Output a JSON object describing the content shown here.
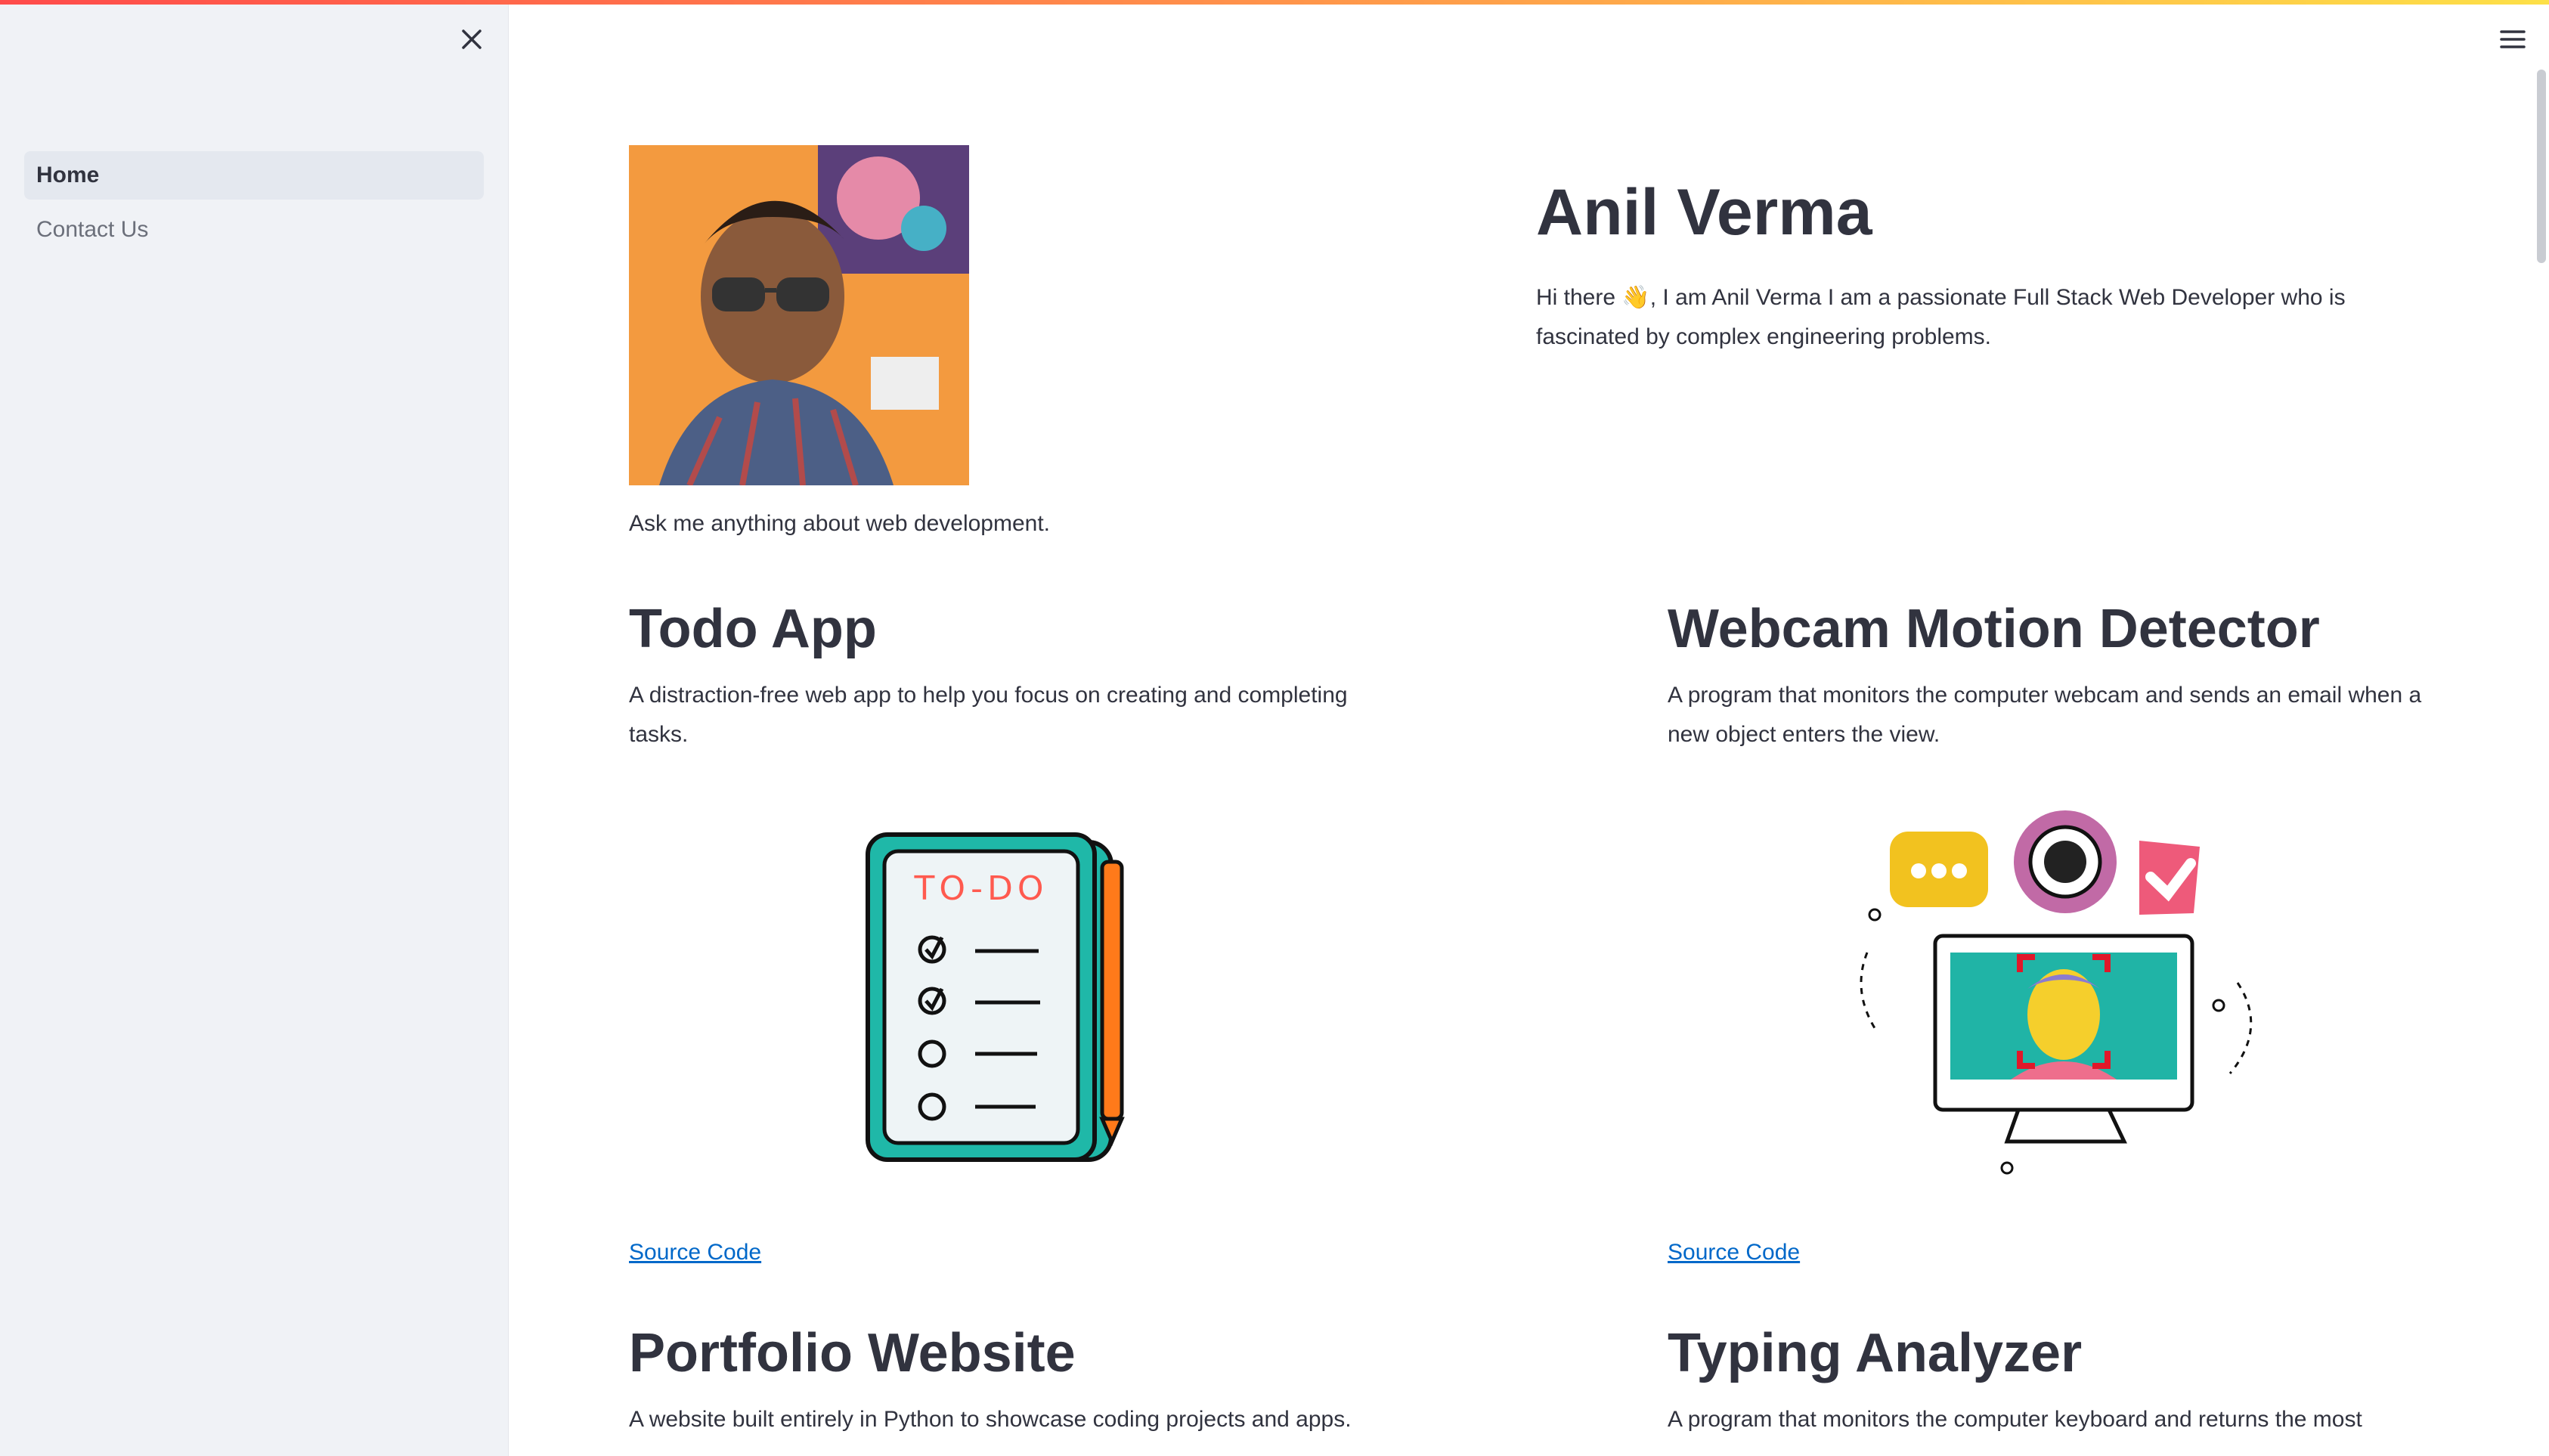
{
  "sidebar": {
    "items": [
      {
        "label": "Home",
        "active": true
      },
      {
        "label": "Contact Us",
        "active": false
      }
    ]
  },
  "profile": {
    "name": "Anil Verma",
    "intro": "Hi there 👋, I am Anil Verma I am a passionate Full Stack Web Developer who is fascinated by complex engineering problems.",
    "tagline": "Ask me anything about web development."
  },
  "projects": [
    {
      "title": "Todo App",
      "description": "A distraction-free web app to help you focus on creating and completing tasks.",
      "link": "Source Code",
      "illustration_text": "TO-DO"
    },
    {
      "title": "Webcam Motion Detector",
      "description": "A program that monitors the computer webcam and sends an email when a new object enters the view.",
      "link": "Source Code"
    },
    {
      "title": "Portfolio Website",
      "description": "A website built entirely in Python to showcase coding projects and apps."
    },
    {
      "title": "Typing Analyzer",
      "description": "A program that monitors the computer keyboard and returns the most"
    }
  ],
  "colors": {
    "accent_red": "#ff4b4b",
    "link_blue": "#0068c9",
    "sidebar_bg": "#f0f2f6",
    "text": "#31333f"
  },
  "icons": {
    "close": "close-icon",
    "menu": "hamburger-menu-icon"
  }
}
